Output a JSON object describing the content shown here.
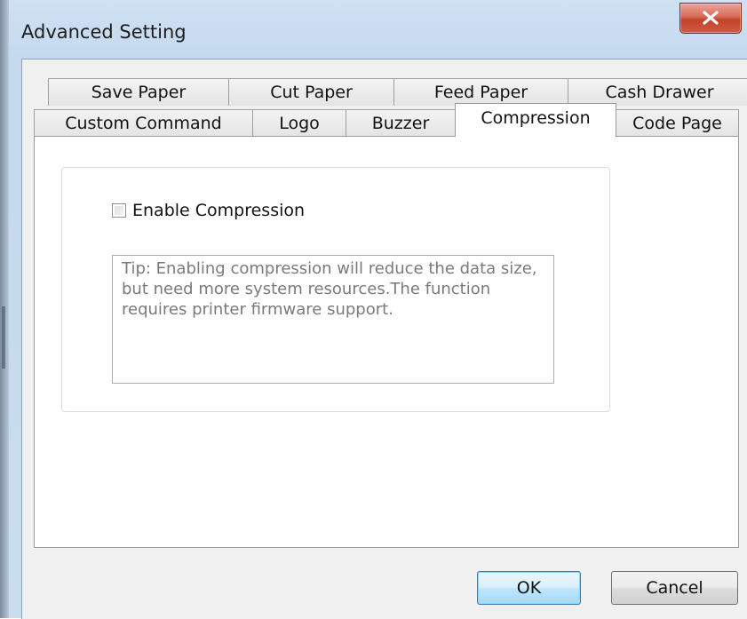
{
  "window": {
    "title": "Advanced Setting",
    "close_label": "X"
  },
  "tabs": {
    "row1": [
      {
        "label": "Save Paper"
      },
      {
        "label": "Cut Paper"
      },
      {
        "label": "Feed Paper"
      },
      {
        "label": "Cash Drawer"
      }
    ],
    "row2": [
      {
        "label": "Custom Command"
      },
      {
        "label": "Logo"
      },
      {
        "label": "Buzzer"
      },
      {
        "label": "Compression"
      },
      {
        "label": "Code Page"
      }
    ],
    "active": "Compression"
  },
  "compression": {
    "enable_label": "Enable Compression",
    "enable_checked": false,
    "tip": "Tip: Enabling compression will reduce the data size, but need more system resources.The function requires printer firmware support."
  },
  "buttons": {
    "ok": "OK",
    "cancel": "Cancel"
  },
  "colors": {
    "title_bar": "#c4d8ee",
    "close_button": "#c4412a",
    "default_button": "#bee6fd"
  }
}
